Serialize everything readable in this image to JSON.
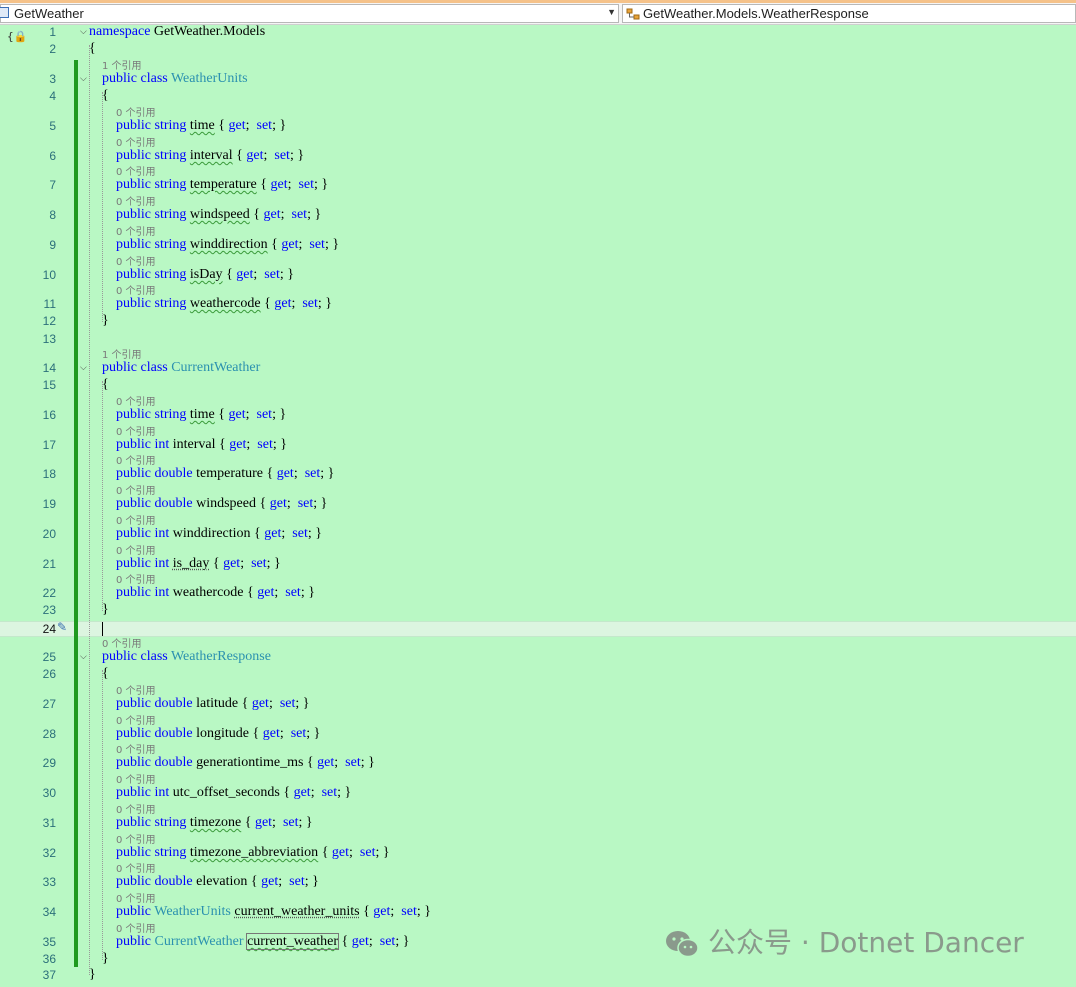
{
  "navbar": {
    "project": "GetWeather",
    "member": "GetWeather.Models.WeatherResponse"
  },
  "watermark": "公众号 · Dotnet Dancer",
  "lines": [
    {
      "n": "1",
      "text": [
        [
          "kw",
          "namespace"
        ],
        [
          "",
          "GetWeather.Models"
        ]
      ]
    },
    {
      "n": "2",
      "text": [
        [
          "",
          "{"
        ]
      ]
    },
    {
      "n": "3",
      "lens": "1 个引用",
      "text": [
        [
          "kw",
          "public"
        ],
        [
          "kw",
          "class"
        ],
        [
          "ty",
          "WeatherUnits"
        ]
      ]
    },
    {
      "n": "4",
      "text": [
        [
          "",
          "{"
        ]
      ]
    },
    {
      "n": "5",
      "lens": "0 个引用",
      "text": [
        [
          "kw",
          "public"
        ],
        [
          "kw",
          "string"
        ],
        [
          "sq",
          "time"
        ],
        [
          "",
          "{ "
        ],
        [
          "kw",
          "get"
        ],
        [
          "",
          "; "
        ],
        [
          "kw",
          "set"
        ],
        [
          "",
          "; }"
        ]
      ]
    },
    {
      "n": "6",
      "lens": "0 个引用",
      "text": [
        [
          "kw",
          "public"
        ],
        [
          "kw",
          "string"
        ],
        [
          "sq",
          "interval"
        ],
        [
          "",
          "{ "
        ],
        [
          "kw",
          "get"
        ],
        [
          "",
          "; "
        ],
        [
          "kw",
          "set"
        ],
        [
          "",
          "; }"
        ]
      ]
    },
    {
      "n": "7",
      "lens": "0 个引用",
      "text": [
        [
          "kw",
          "public"
        ],
        [
          "kw",
          "string"
        ],
        [
          "sq",
          "temperature"
        ],
        [
          "",
          "{ "
        ],
        [
          "kw",
          "get"
        ],
        [
          "",
          "; "
        ],
        [
          "kw",
          "set"
        ],
        [
          "",
          "; }"
        ]
      ]
    },
    {
      "n": "8",
      "lens": "0 个引用",
      "text": [
        [
          "kw",
          "public"
        ],
        [
          "kw",
          "string"
        ],
        [
          "sq",
          "windspeed"
        ],
        [
          "",
          "{ "
        ],
        [
          "kw",
          "get"
        ],
        [
          "",
          "; "
        ],
        [
          "kw",
          "set"
        ],
        [
          "",
          "; }"
        ]
      ]
    },
    {
      "n": "9",
      "lens": "0 个引用",
      "text": [
        [
          "kw",
          "public"
        ],
        [
          "kw",
          "string"
        ],
        [
          "sq",
          "winddirection"
        ],
        [
          "",
          "{ "
        ],
        [
          "kw",
          "get"
        ],
        [
          "",
          "; "
        ],
        [
          "kw",
          "set"
        ],
        [
          "",
          "; }"
        ]
      ]
    },
    {
      "n": "10",
      "lens": "0 个引用",
      "text": [
        [
          "kw",
          "public"
        ],
        [
          "kw",
          "string"
        ],
        [
          "sq",
          "isDay"
        ],
        [
          "",
          "{ "
        ],
        [
          "kw",
          "get"
        ],
        [
          "",
          "; "
        ],
        [
          "kw",
          "set"
        ],
        [
          "",
          "; }"
        ]
      ]
    },
    {
      "n": "11",
      "lens": "0 个引用",
      "text": [
        [
          "kw",
          "public"
        ],
        [
          "kw",
          "string"
        ],
        [
          "sq",
          "weathercode"
        ],
        [
          "",
          "{ "
        ],
        [
          "kw",
          "get"
        ],
        [
          "",
          "; "
        ],
        [
          "kw",
          "set"
        ],
        [
          "",
          "; }"
        ]
      ]
    },
    {
      "n": "12",
      "text": [
        [
          "",
          "}"
        ]
      ]
    },
    {
      "n": "13",
      "text": []
    },
    {
      "n": "14",
      "lens": "1 个引用",
      "text": [
        [
          "kw",
          "public"
        ],
        [
          "kw",
          "class"
        ],
        [
          "ty",
          "CurrentWeather"
        ]
      ]
    },
    {
      "n": "15",
      "text": [
        [
          "",
          "{"
        ]
      ]
    },
    {
      "n": "16",
      "lens": "0 个引用",
      "text": [
        [
          "kw",
          "public"
        ],
        [
          "kw",
          "string"
        ],
        [
          "sq",
          "time"
        ],
        [
          "",
          "{ "
        ],
        [
          "kw",
          "get"
        ],
        [
          "",
          "; "
        ],
        [
          "kw",
          "set"
        ],
        [
          "",
          "; }"
        ]
      ]
    },
    {
      "n": "17",
      "lens": "0 个引用",
      "text": [
        [
          "kw",
          "public"
        ],
        [
          "kw",
          "int"
        ],
        [
          "",
          "interval"
        ],
        [
          "",
          "{ "
        ],
        [
          "kw",
          "get"
        ],
        [
          "",
          "; "
        ],
        [
          "kw",
          "set"
        ],
        [
          "",
          "; }"
        ]
      ]
    },
    {
      "n": "18",
      "lens": "0 个引用",
      "text": [
        [
          "kw",
          "public"
        ],
        [
          "kw",
          "double"
        ],
        [
          "",
          "temperature"
        ],
        [
          "",
          "{ "
        ],
        [
          "kw",
          "get"
        ],
        [
          "",
          "; "
        ],
        [
          "kw",
          "set"
        ],
        [
          "",
          "; }"
        ]
      ]
    },
    {
      "n": "19",
      "lens": "0 个引用",
      "text": [
        [
          "kw",
          "public"
        ],
        [
          "kw",
          "double"
        ],
        [
          "",
          "windspeed"
        ],
        [
          "",
          "{ "
        ],
        [
          "kw",
          "get"
        ],
        [
          "",
          "; "
        ],
        [
          "kw",
          "set"
        ],
        [
          "",
          "; }"
        ]
      ]
    },
    {
      "n": "20",
      "lens": "0 个引用",
      "text": [
        [
          "kw",
          "public"
        ],
        [
          "kw",
          "int"
        ],
        [
          "",
          "winddirection"
        ],
        [
          "",
          "{ "
        ],
        [
          "kw",
          "get"
        ],
        [
          "",
          "; "
        ],
        [
          "kw",
          "set"
        ],
        [
          "",
          "; }"
        ]
      ]
    },
    {
      "n": "21",
      "lens": "0 个引用",
      "text": [
        [
          "kw",
          "public"
        ],
        [
          "kw",
          "int"
        ],
        [
          "sqd",
          "is_day"
        ],
        [
          "",
          "{ "
        ],
        [
          "kw",
          "get"
        ],
        [
          "",
          "; "
        ],
        [
          "kw",
          "set"
        ],
        [
          "",
          "; }"
        ]
      ]
    },
    {
      "n": "22",
      "lens": "0 个引用",
      "text": [
        [
          "kw",
          "public"
        ],
        [
          "kw",
          "int"
        ],
        [
          "",
          "weathercode"
        ],
        [
          "",
          "{ "
        ],
        [
          "kw",
          "get"
        ],
        [
          "",
          "; "
        ],
        [
          "kw",
          "set"
        ],
        [
          "",
          "; }"
        ]
      ]
    },
    {
      "n": "23",
      "text": [
        [
          "",
          "}"
        ]
      ]
    },
    {
      "n": "24",
      "current": true,
      "text": []
    },
    {
      "n": "25",
      "lens": "0 个引用",
      "text": [
        [
          "kw",
          "public"
        ],
        [
          "kw",
          "class"
        ],
        [
          "ty",
          "WeatherResponse"
        ]
      ]
    },
    {
      "n": "26",
      "text": [
        [
          "",
          "{"
        ]
      ]
    },
    {
      "n": "27",
      "lens": "0 个引用",
      "text": [
        [
          "kw",
          "public"
        ],
        [
          "kw",
          "double"
        ],
        [
          "",
          "latitude"
        ],
        [
          "",
          "{ "
        ],
        [
          "kw",
          "get"
        ],
        [
          "",
          "; "
        ],
        [
          "kw",
          "set"
        ],
        [
          "",
          "; }"
        ]
      ]
    },
    {
      "n": "28",
      "lens": "0 个引用",
      "text": [
        [
          "kw",
          "public"
        ],
        [
          "kw",
          "double"
        ],
        [
          "",
          "longitude"
        ],
        [
          "",
          "{ "
        ],
        [
          "kw",
          "get"
        ],
        [
          "",
          "; "
        ],
        [
          "kw",
          "set"
        ],
        [
          "",
          "; }"
        ]
      ]
    },
    {
      "n": "29",
      "lens": "0 个引用",
      "text": [
        [
          "kw",
          "public"
        ],
        [
          "kw",
          "double"
        ],
        [
          "",
          "generationtime_ms"
        ],
        [
          "",
          "{ "
        ],
        [
          "kw",
          "get"
        ],
        [
          "",
          "; "
        ],
        [
          "kw",
          "set"
        ],
        [
          "",
          "; }"
        ]
      ]
    },
    {
      "n": "30",
      "lens": "0 个引用",
      "text": [
        [
          "kw",
          "public"
        ],
        [
          "kw",
          "int"
        ],
        [
          "",
          "utc_offset_seconds"
        ],
        [
          "",
          "{ "
        ],
        [
          "kw",
          "get"
        ],
        [
          "",
          "; "
        ],
        [
          "kw",
          "set"
        ],
        [
          "",
          "; }"
        ]
      ]
    },
    {
      "n": "31",
      "lens": "0 个引用",
      "text": [
        [
          "kw",
          "public"
        ],
        [
          "kw",
          "string"
        ],
        [
          "sq",
          "timezone"
        ],
        [
          "",
          "{ "
        ],
        [
          "kw",
          "get"
        ],
        [
          "",
          "; "
        ],
        [
          "kw",
          "set"
        ],
        [
          "",
          "; }"
        ]
      ]
    },
    {
      "n": "32",
      "lens": "0 个引用",
      "text": [
        [
          "kw",
          "public"
        ],
        [
          "kw",
          "string"
        ],
        [
          "sq",
          "timezone_abbreviation"
        ],
        [
          "",
          "{ "
        ],
        [
          "kw",
          "get"
        ],
        [
          "",
          "; "
        ],
        [
          "kw",
          "set"
        ],
        [
          "",
          "; }"
        ]
      ]
    },
    {
      "n": "33",
      "lens": "0 个引用",
      "text": [
        [
          "kw",
          "public"
        ],
        [
          "kw",
          "double"
        ],
        [
          "",
          "elevation"
        ],
        [
          "",
          "{ "
        ],
        [
          "kw",
          "get"
        ],
        [
          "",
          "; "
        ],
        [
          "kw",
          "set"
        ],
        [
          "",
          "; }"
        ]
      ]
    },
    {
      "n": "34",
      "lens": "0 个引用",
      "text": [
        [
          "kw",
          "public"
        ],
        [
          "ty",
          "WeatherUnits"
        ],
        [
          "sqd",
          "current_weather_units"
        ],
        [
          "",
          "{ "
        ],
        [
          "kw",
          "get"
        ],
        [
          "",
          "; "
        ],
        [
          "kw",
          "set"
        ],
        [
          "",
          "; }"
        ]
      ]
    },
    {
      "n": "35",
      "lens": "0 个引用",
      "text": [
        [
          "kw",
          "public"
        ],
        [
          "ty",
          "CurrentWeather"
        ],
        [
          "boxsq",
          "current_weather"
        ],
        [
          "",
          "{ "
        ],
        [
          "kw",
          "get"
        ],
        [
          "",
          "; "
        ],
        [
          "kw",
          "set"
        ],
        [
          "",
          "; }"
        ]
      ]
    },
    {
      "n": "36",
      "text": [
        [
          "",
          "}"
        ]
      ]
    },
    {
      "n": "37",
      "text": [
        [
          "",
          "}"
        ]
      ]
    }
  ]
}
